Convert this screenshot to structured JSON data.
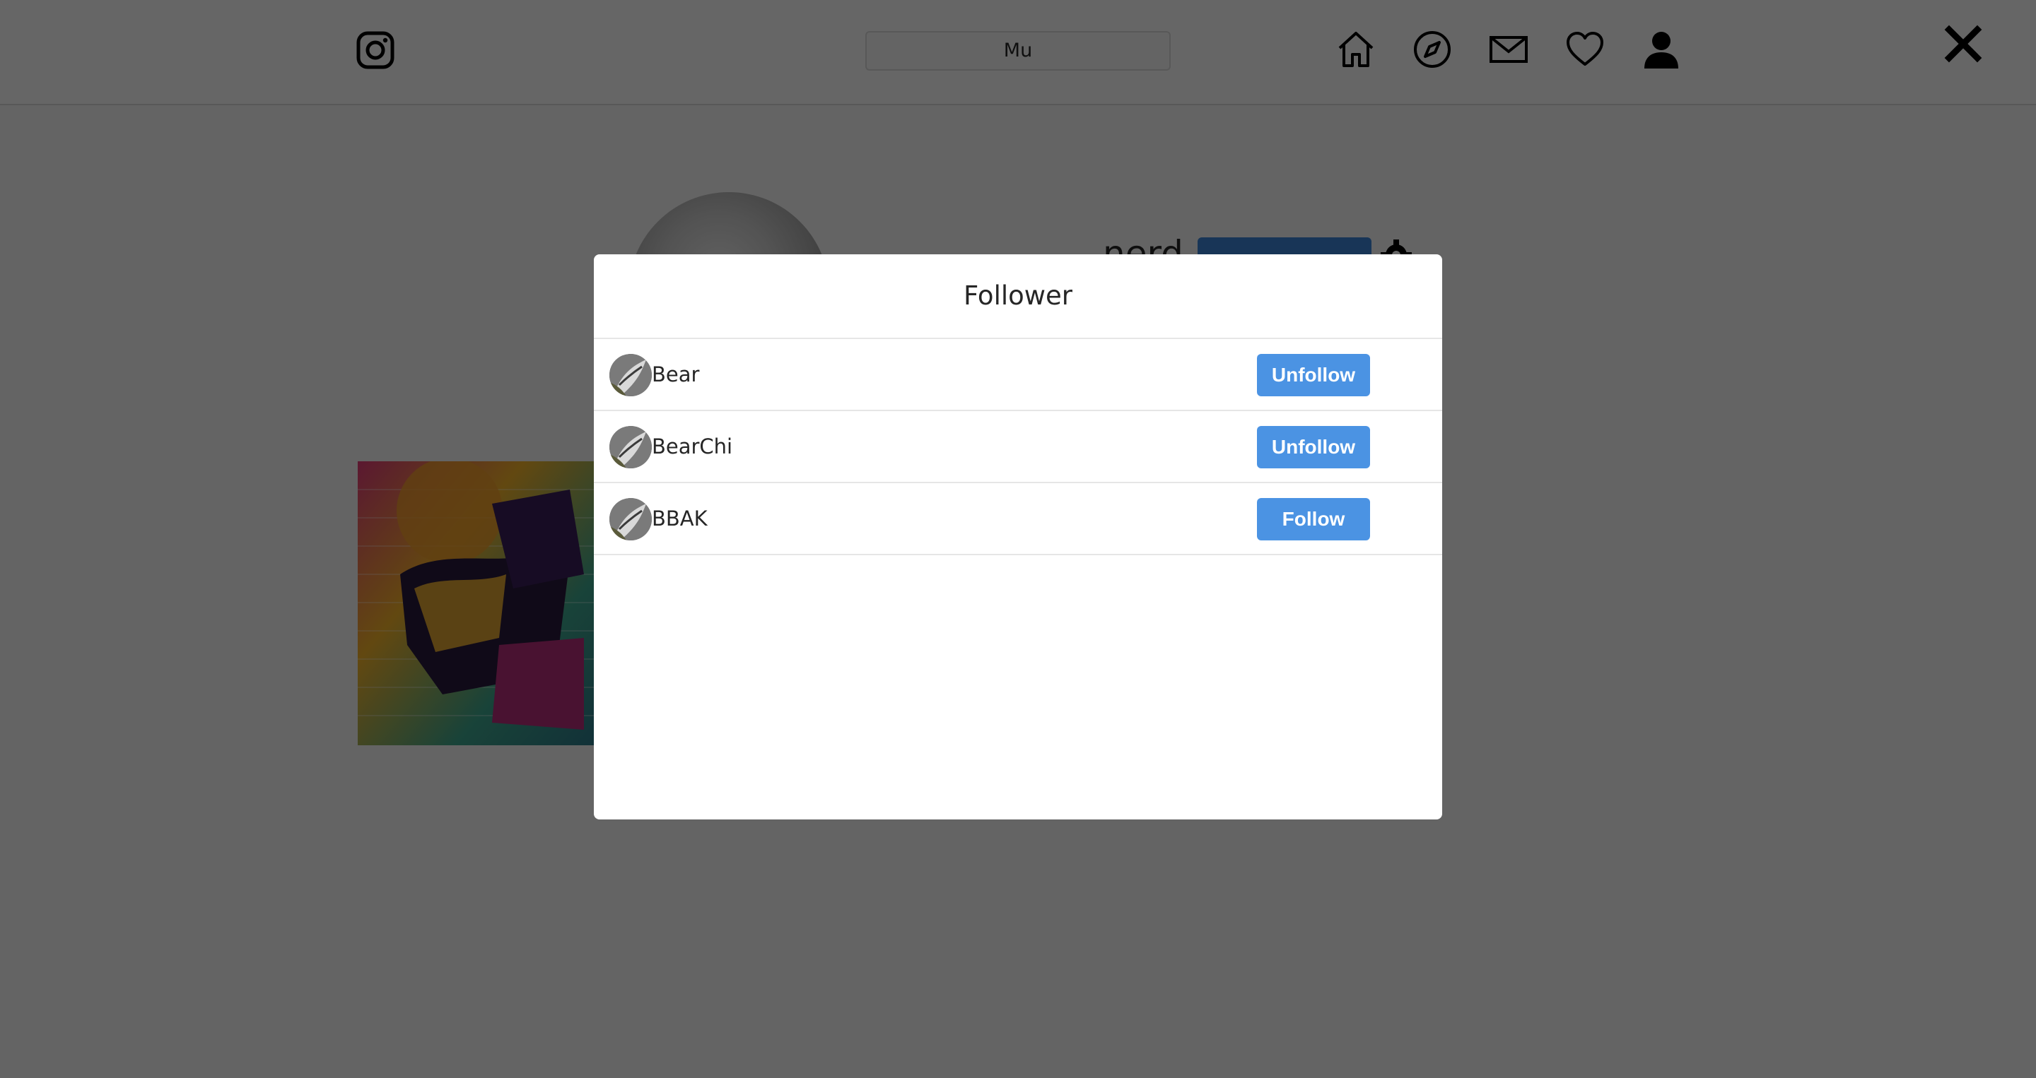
{
  "header": {
    "logo_icon": "instagram-icon",
    "search_value": "Mu",
    "nav_icons": [
      "home-icon",
      "explore-icon",
      "mail-icon",
      "heart-icon",
      "profile-icon"
    ]
  },
  "profile": {
    "username_partial": "nerd"
  },
  "overlay": {
    "close_icon": "close-icon"
  },
  "modal": {
    "title": "Follower",
    "rows": [
      {
        "name": "Bear",
        "button": "Unfollow"
      },
      {
        "name": "BearChi",
        "button": "Unfollow"
      },
      {
        "name": "BBAK",
        "button": "Follow"
      }
    ]
  },
  "colors": {
    "button_blue": "#4b93e3",
    "overlay": "rgba(0,0,0,0.6)"
  }
}
